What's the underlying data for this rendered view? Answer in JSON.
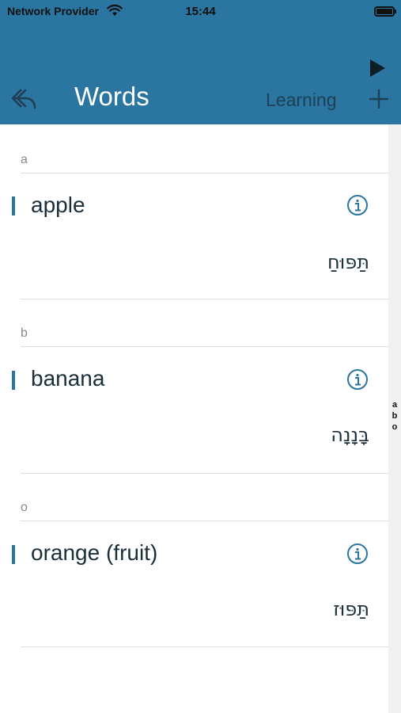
{
  "status_bar": {
    "carrier": "Network Provider",
    "time": "15:44",
    "wifi_icon": "wifi-icon",
    "battery_icon": "battery-icon"
  },
  "nav": {
    "title": "Words",
    "learning_label": "Learning",
    "back_icon": "reply-arrow-icon",
    "play_icon": "play-icon",
    "add_icon": "plus-icon"
  },
  "sections": [
    {
      "header": "a",
      "word": "apple",
      "translation": "תַּפּוּחַ"
    },
    {
      "header": "b",
      "word": "banana",
      "translation": "בָּנָנָה"
    },
    {
      "header": "o",
      "word": "orange (fruit)",
      "translation": "תַּפּוּז"
    }
  ],
  "index": [
    "a",
    "b",
    "o"
  ],
  "colors": {
    "accent": "#2a76a0",
    "title_text": "#ffffff",
    "secondary_nav_text": "#1e3f55"
  }
}
